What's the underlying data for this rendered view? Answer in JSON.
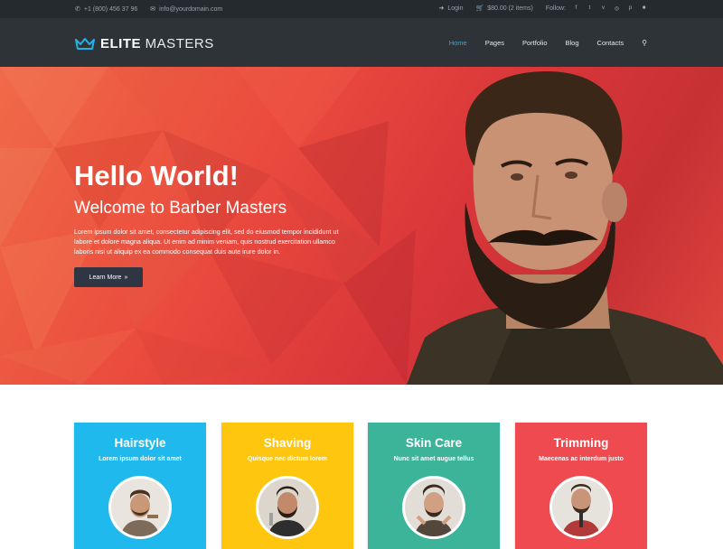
{
  "topbar": {
    "phone": "+1 (800) 456 37 96",
    "email": "info@yourdomain.com",
    "login": "Login",
    "cart": "$80.00 (2 items)",
    "follow": "Follow:",
    "socials": [
      "facebook-icon",
      "twitter-icon",
      "vimeo-icon",
      "dribbble-icon",
      "pinterest-icon",
      "flickr-icon"
    ]
  },
  "brand": {
    "bold": "ELITE",
    "thin": " MASTERS",
    "accent": "#1fb3ea"
  },
  "nav": {
    "items": [
      "Home",
      "Pages",
      "Portfolio",
      "Blog",
      "Contacts"
    ],
    "active": "Home"
  },
  "hero": {
    "title": "Hello World!",
    "subtitle": "Welcome to Barber Masters",
    "body": "Lorem ipsum dolor sit amet, consectetur adipiscing elit, sed do eiusmod tempor incididunt ut labore et dolore magna aliqua. Ut enim ad minim veniam, quis nostrud exercitation ullamco laboris nisi ut aliquip ex ea commodo consequat duis aute irure dolor in.",
    "button": "Learn More"
  },
  "services": [
    {
      "title": "Hairstyle",
      "desc": "Lorem ipsum dolor sit amet",
      "color": "#1fb9ed"
    },
    {
      "title": "Shaving",
      "desc": "Quisque nec dictum lorem",
      "color": "#fec60f"
    },
    {
      "title": "Skin Care",
      "desc": "Nunc sit amet augue tellus",
      "color": "#3bb49a"
    },
    {
      "title": "Trimming",
      "desc": "Maecenas ac interdum justo",
      "color": "#ef4a4f"
    }
  ]
}
